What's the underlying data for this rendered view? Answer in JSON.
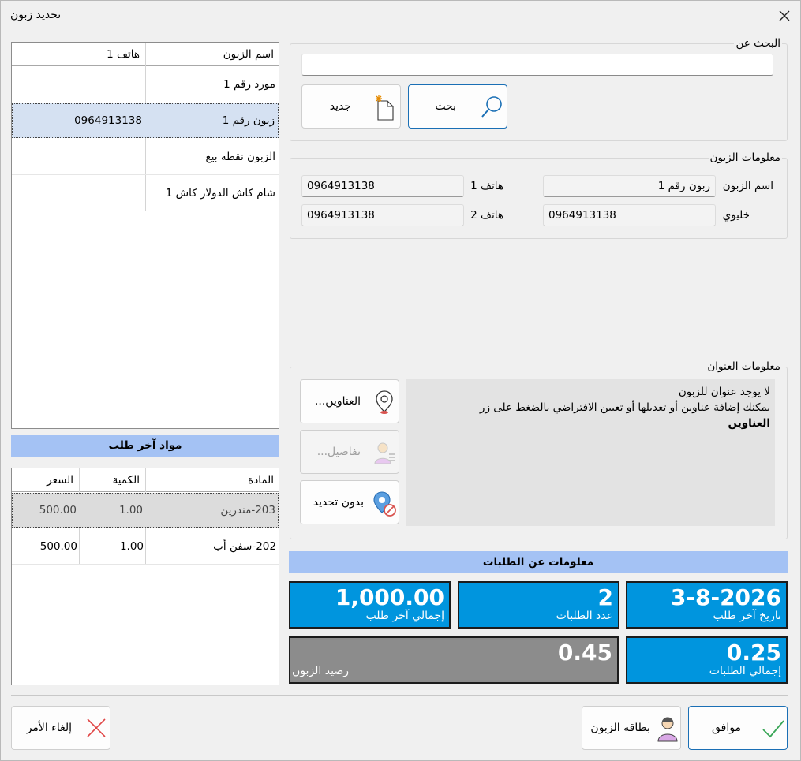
{
  "window": {
    "title": "تحديد زبون"
  },
  "search": {
    "group_title": "البحث عن",
    "value": "",
    "search_label": "بحث",
    "new_label": "جديد"
  },
  "customer_info": {
    "group_title": "معلومات الزبون",
    "name_label": "اسم الزبون",
    "name_value": "زبون رقم 1",
    "phone1_label": "هاتف 1",
    "phone1_value": "0964913138",
    "mobile_label": "خليوي",
    "mobile_value": "0964913138",
    "phone2_label": "هاتف 2",
    "phone2_value": "0964913138"
  },
  "address_info": {
    "group_title": "معلومات العنوان",
    "message_line1": "لا يوجد عنوان للزبون",
    "message_line2": "يمكنك إضافة عناوين أو تعديلها أو تعيين الافتراضي بالضغط على زر",
    "message_bold": "العناوين",
    "addresses_label": "العناوين...",
    "details_label": "تفاصيل...",
    "no_select_label": "بدون تحديد"
  },
  "customers_grid": {
    "columns": [
      "اسم الزبون",
      "هاتف 1"
    ],
    "rows": [
      {
        "name": "مورد رقم 1",
        "phone": ""
      },
      {
        "name": "زبون رقم 1",
        "phone": "0964913138"
      },
      {
        "name": "الزبون نقطة بيع",
        "phone": ""
      },
      {
        "name": "شام كاش الدولار كاش 1",
        "phone": ""
      }
    ]
  },
  "last_order": {
    "bar_title": "مواد آخر طلب",
    "columns": [
      "المادة",
      "الكمية",
      "السعر"
    ],
    "rows": [
      {
        "item": "203-مندرين",
        "qty": "1.00",
        "price": "500.00"
      },
      {
        "item": "202-سفن أب",
        "qty": "1.00",
        "price": "500.00"
      }
    ]
  },
  "orders_info": {
    "bar_title": "معلومات عن الطلبات",
    "tiles": {
      "last_order_date": {
        "value": "3-8-2026",
        "caption": "تاريخ آخر طلب"
      },
      "order_count": {
        "value": "2",
        "caption": "عدد الطلبات"
      },
      "last_order_total": {
        "value": "1,000.00",
        "caption": "إجمالي آخر طلب"
      },
      "orders_total": {
        "value": "0.25",
        "caption": "إجمالي الطلبات"
      },
      "customer_balance": {
        "value": "0.45",
        "caption": "رصيد الزبون"
      }
    }
  },
  "footer": {
    "ok_label": "موافق",
    "card_label": "بطاقة الزبون",
    "cancel_label": "إلغاء الأمر"
  },
  "colors": {
    "accent": "#0095de",
    "bar": "#a4c2f4",
    "selected_row": "#d5e1f2",
    "balance_tile": "#8c8c8c"
  }
}
